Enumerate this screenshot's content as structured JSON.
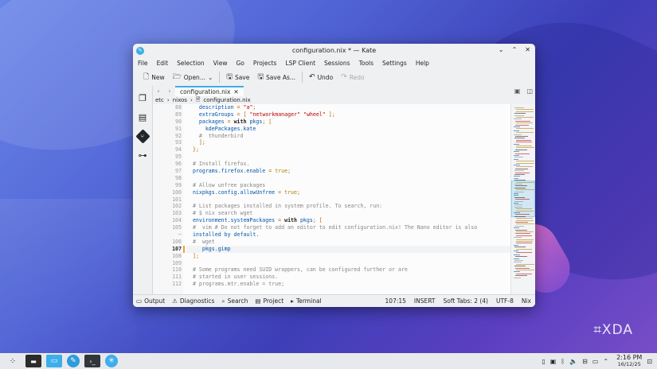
{
  "window": {
    "title": "configuration.nix * — Kate",
    "menu": [
      "File",
      "Edit",
      "Selection",
      "View",
      "Go",
      "Projects",
      "LSP Client",
      "Sessions",
      "Tools",
      "Settings",
      "Help"
    ]
  },
  "toolbar": {
    "new_label": "New",
    "open_label": "Open...",
    "save_label": "Save",
    "save_as_label": "Save As...",
    "undo_label": "Undo",
    "redo_label": "Redo"
  },
  "tab": {
    "label": "configuration.nix"
  },
  "breadcrumb": [
    "etc",
    "nixos",
    "configuration.nix"
  ],
  "code": {
    "current_line": "107",
    "lines": [
      {
        "n": "88",
        "t": "    description = \"a\";"
      },
      {
        "n": "89",
        "t": "    extraGroups = [ \"networkmanager\" \"wheel\" ];"
      },
      {
        "n": "90",
        "t": "    packages = with pkgs; ["
      },
      {
        "n": "91",
        "t": "      kdePackages.kate"
      },
      {
        "n": "92",
        "t": "    #  thunderbird"
      },
      {
        "n": "93",
        "t": "    ];"
      },
      {
        "n": "94",
        "t": "  };"
      },
      {
        "n": "95",
        "t": ""
      },
      {
        "n": "96",
        "t": "  # Install firefox."
      },
      {
        "n": "97",
        "t": "  programs.firefox.enable = true;"
      },
      {
        "n": "98",
        "t": ""
      },
      {
        "n": "99",
        "t": "  # Allow unfree packages"
      },
      {
        "n": "100",
        "t": "  nixpkgs.config.allowUnfree = true;"
      },
      {
        "n": "101",
        "t": ""
      },
      {
        "n": "102",
        "t": "  # List packages installed in system profile. To search, run:"
      },
      {
        "n": "103",
        "t": "  # $ nix search wget"
      },
      {
        "n": "104",
        "t": "  environment.systemPackages = with pkgs; ["
      },
      {
        "n": "105",
        "t": "  #  vim # Do not forget to add an editor to edit configuration.nix! The Nano editor is also"
      },
      {
        "n": "~",
        "t": "  installed by default."
      },
      {
        "n": "106",
        "t": "  #  wget"
      },
      {
        "n": "107",
        "t": "     pkgs.gimp"
      },
      {
        "n": "108",
        "t": "  ];"
      },
      {
        "n": "109",
        "t": ""
      },
      {
        "n": "110",
        "t": "  # Some programs need SUID wrappers, can be configured further or are"
      },
      {
        "n": "111",
        "t": "  # started in user sessions."
      },
      {
        "n": "112",
        "t": "  # programs.mtr.enable = true;"
      }
    ]
  },
  "statusbar": {
    "left": [
      "Output",
      "Diagnostics",
      "Search",
      "Project",
      "Terminal"
    ],
    "right": [
      "107:15",
      "INSERT",
      "Soft Tabs: 2 (4)",
      "UTF-8",
      "Nix"
    ]
  },
  "taskbar": {
    "time": "2:16 PM",
    "date": "16/12/25"
  },
  "watermark": "XDA",
  "colors": {
    "accent": "#3daee9",
    "current_line_marker": "#f0a030"
  }
}
